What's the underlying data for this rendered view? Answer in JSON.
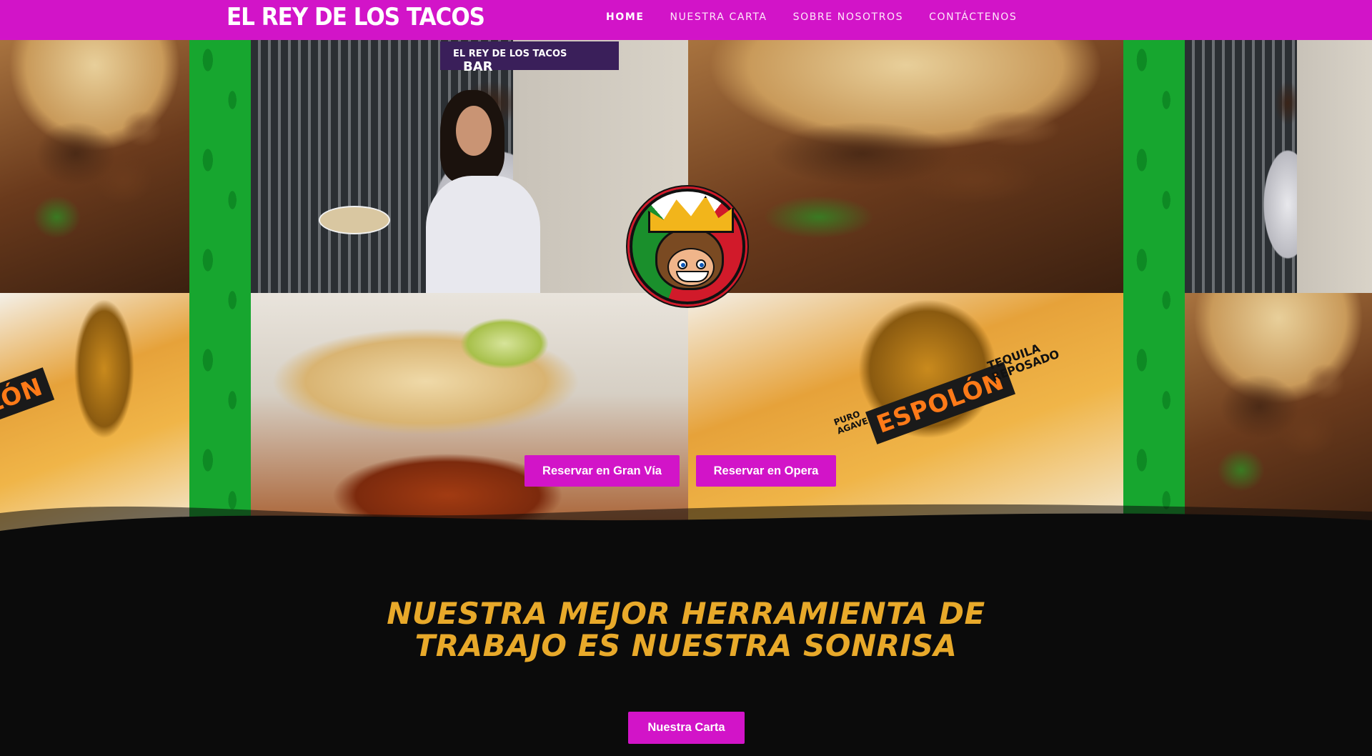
{
  "header": {
    "logo_text": "EL REY DE LOS TACOS",
    "nav": [
      {
        "label": "HOME",
        "active": true
      },
      {
        "label": "NUESTRA CARTA",
        "active": false
      },
      {
        "label": "SOBRE NOSOTROS",
        "active": false
      },
      {
        "label": "CONTÁCTENOS",
        "active": false
      }
    ]
  },
  "hero": {
    "shop_sign": "EL REY DE LOS TACOS",
    "shop_sign_right": "BAR",
    "bottle_brand": "ESPOLÓN",
    "bottle_brand_left": "LÓN",
    "bottle_type": "TEQUILA REPOSADO",
    "bottle_subtext": "PURO AGAVE",
    "buttons": {
      "gran_via": "Reservar en Gran Vía",
      "opera": "Reservar en Opera"
    }
  },
  "section": {
    "tagline_line1": "NUESTRA MEJOR HERRAMIENTA DE",
    "tagline_line2": "TRABAJO ES NUESTRA SONRISA",
    "carta_button": "Nuestra Carta"
  },
  "colors": {
    "brand": "#d214c8",
    "accent_text": "#e8a92a",
    "background": "#0b0b0b",
    "green": "#17a62f"
  }
}
